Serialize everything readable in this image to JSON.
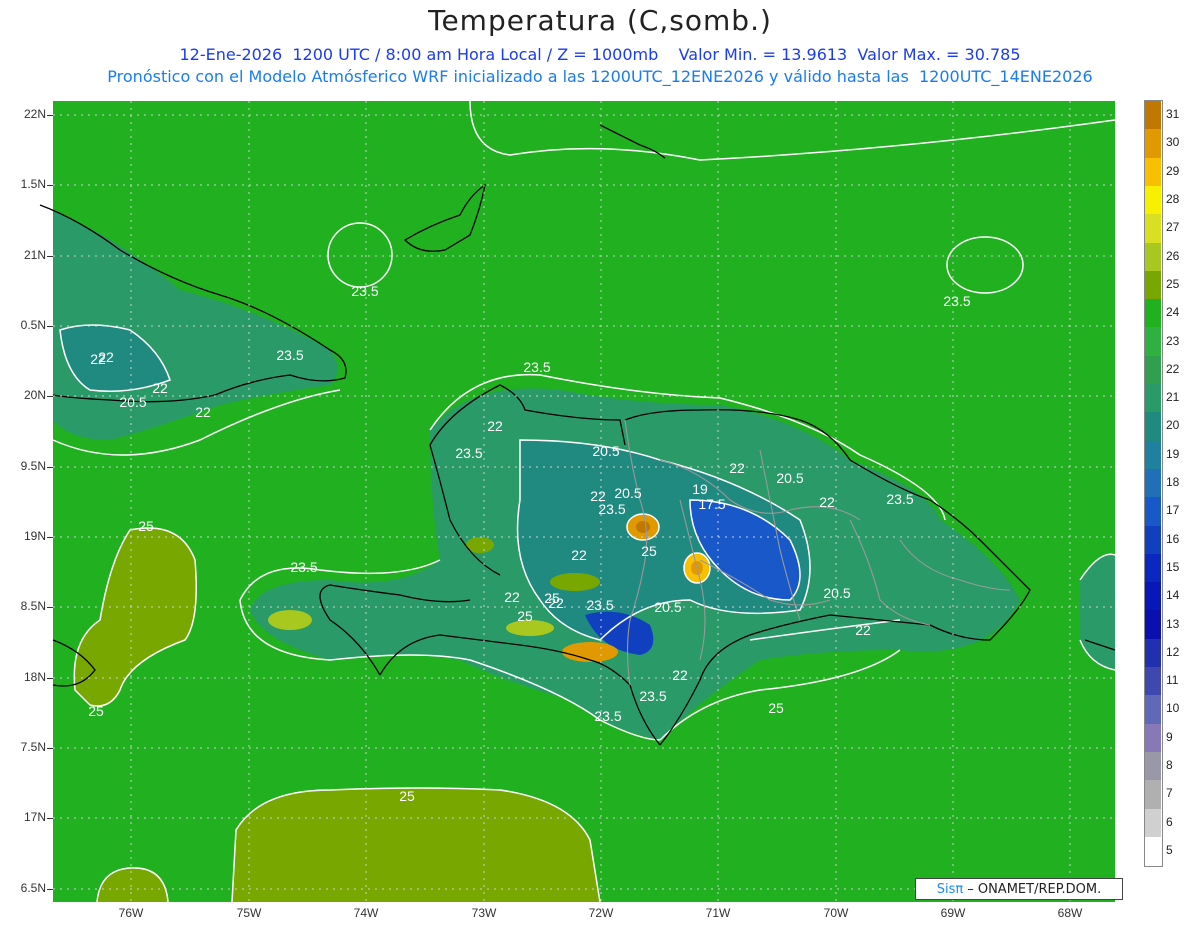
{
  "title": "Temperatura (C,somb.)",
  "subtitle_line1": "12-Ene-2026  1200 UTC / 8:00 am Hora Local / Z = 1000mb    Valor Min. = 13.9613  Valor Max. = 30.785",
  "subtitle_line2": "Pronóstico con el Modelo Atmósferico WRF inicializado a las 1200UTC_12ENE2026 y válido hasta las  1200UTC_14ENE2026",
  "credit": {
    "brand": "Sisπ",
    "text": "– ONAMET/REP.DOM."
  },
  "lat_labels": [
    "22N",
    "1.5N",
    "21N",
    "0.5N",
    "20N",
    "9.5N",
    "19N",
    "8.5N",
    "18N",
    "7.5N",
    "17N",
    "6.5N"
  ],
  "lon_labels": [
    "76W",
    "75W",
    "74W",
    "73W",
    "72W",
    "71W",
    "70W",
    "69W",
    "68W"
  ],
  "colorbar": {
    "labels": [
      "31",
      "30",
      "29",
      "28",
      "27",
      "26",
      "25",
      "24",
      "23",
      "22",
      "21",
      "20",
      "19",
      "18",
      "17",
      "16",
      "15",
      "14",
      "13",
      "12",
      "11",
      "10",
      "9",
      "8",
      "7",
      "6",
      "5"
    ],
    "colors": [
      "#c07800",
      "#e09a00",
      "#f8c000",
      "#f8f000",
      "#d8e020",
      "#a8c820",
      "#78a800",
      "#20b020",
      "#30b040",
      "#30a050",
      "#2a9a68",
      "#208a80",
      "#2080a0",
      "#2070b8",
      "#1858c8",
      "#1040c0",
      "#0a28c0",
      "#0818b8",
      "#0a10b0",
      "#2030b0",
      "#4048b0",
      "#6068b8",
      "#8878b8",
      "#9898a8",
      "#b0b0b0",
      "#d0d0d0",
      "#ffffff"
    ]
  },
  "contour_labels": [
    "23.5",
    "23.5",
    "23.5",
    "22",
    "22",
    "20.5",
    "22",
    "23.5",
    "22",
    "23.5",
    "20.5",
    "22",
    "20.5",
    "22",
    "23.5",
    "20.5",
    "19",
    "17.5",
    "25",
    "22",
    "20.5",
    "22",
    "23.5",
    "25",
    "22",
    "22",
    "23.5",
    "20.5",
    "25",
    "22",
    "23.5",
    "22",
    "22",
    "23.5",
    "23.5",
    "25",
    "25",
    "25",
    "25"
  ],
  "legend_colors": {
    "background_field": "#20b020",
    "warm_area": "#78a800",
    "ocean_area": "#2a9a68",
    "contour": "#ffffff",
    "coast": "#000000",
    "border": "#999999"
  }
}
